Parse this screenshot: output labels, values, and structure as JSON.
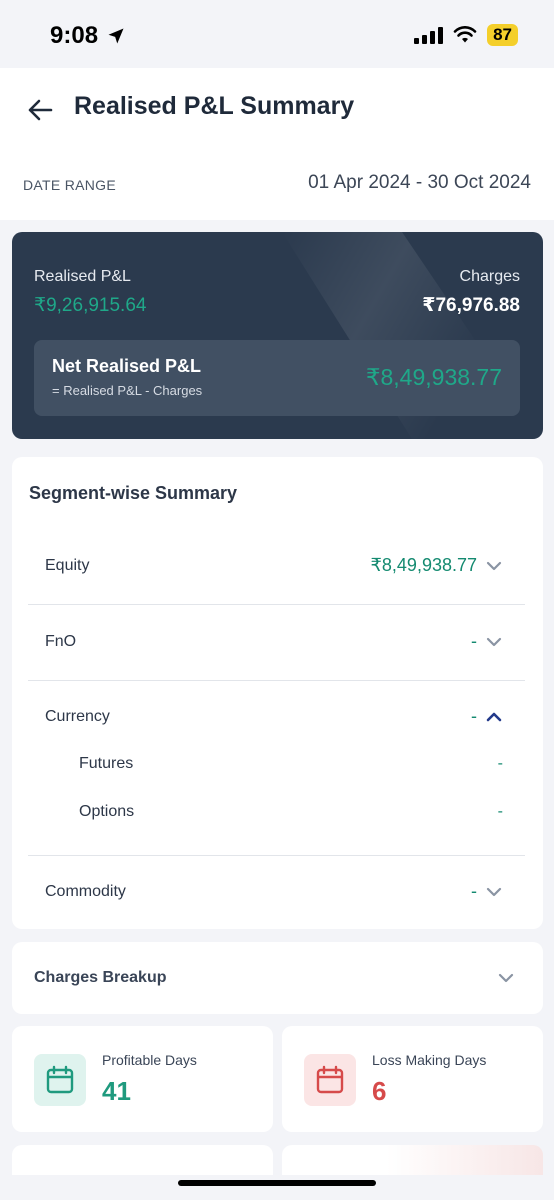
{
  "status_bar": {
    "time": "9:08",
    "battery": "87"
  },
  "header": {
    "title": "Realised P&L Summary",
    "date_range_label": "DATE RANGE",
    "date_range_value": "01 Apr 2024 - 30 Oct 2024"
  },
  "summary": {
    "realised_label": "Realised P&L",
    "realised_value": "₹9,26,915.64",
    "charges_label": "Charges",
    "charges_value": "₹76,976.88",
    "net_title": "Net Realised P&L",
    "net_formula": "= Realised P&L - Charges",
    "net_value": "₹8,49,938.77"
  },
  "segments": {
    "title": "Segment-wise Summary",
    "rows": [
      {
        "name": "Equity",
        "value": "₹8,49,938.77",
        "expanded": false
      },
      {
        "name": "FnO",
        "value": "-",
        "expanded": false
      },
      {
        "name": "Currency",
        "value": "-",
        "expanded": true
      },
      {
        "name": "Commodity",
        "value": "-",
        "expanded": false
      }
    ],
    "currency_sub": [
      {
        "name": "Futures",
        "value": "-"
      },
      {
        "name": "Options",
        "value": "-"
      }
    ]
  },
  "charges_breakup": {
    "title": "Charges Breakup"
  },
  "stats": {
    "profitable": {
      "label": "Profitable Days",
      "value": "41",
      "color": "#1f9a7e",
      "icon_bg": "#dff3ee"
    },
    "loss": {
      "label": "Loss Making Days",
      "value": "6",
      "color": "#d64a4a",
      "icon_bg": "#fbe5e5"
    }
  },
  "colors": {
    "accent_green": "#148a70",
    "dark_card": "#2b3a4e",
    "chevron_active": "#22398a"
  }
}
